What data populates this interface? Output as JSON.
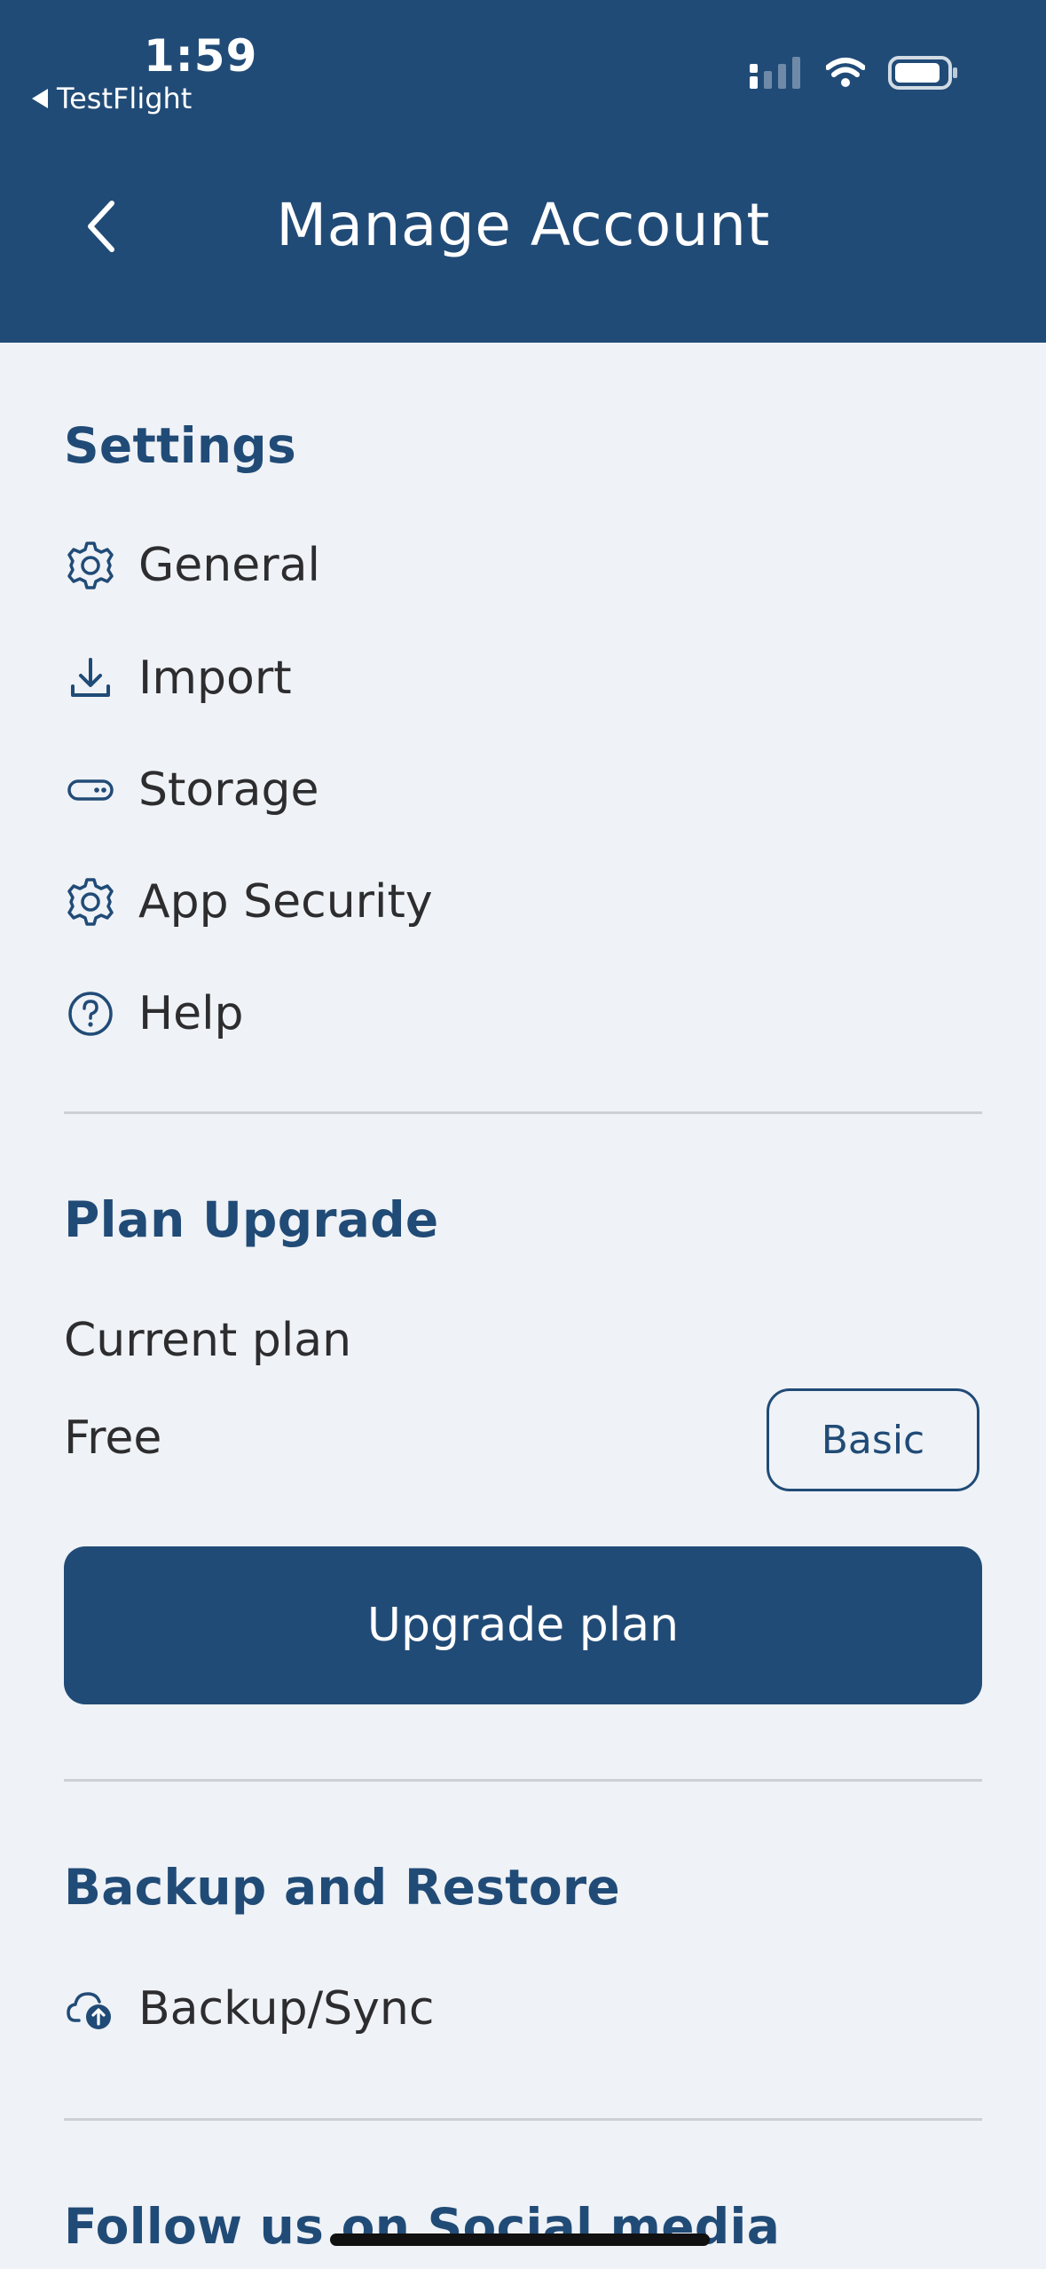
{
  "status_bar": {
    "time": "1:59",
    "back_app": "TestFlight"
  },
  "header": {
    "title": "Manage Account"
  },
  "settings": {
    "title": "Settings",
    "items": [
      {
        "label": "General",
        "icon": "gear-icon"
      },
      {
        "label": "Import",
        "icon": "download-icon"
      },
      {
        "label": "Storage",
        "icon": "storage-icon"
      },
      {
        "label": "App Security",
        "icon": "gear-icon"
      },
      {
        "label": "Help",
        "icon": "help-icon"
      }
    ]
  },
  "plan": {
    "title": "Plan Upgrade",
    "current_label": "Current plan",
    "current_value": "Free",
    "badge": "Basic",
    "upgrade_button": "Upgrade plan"
  },
  "backup": {
    "title": "Backup and Restore",
    "items": [
      {
        "label": "Backup/Sync",
        "icon": "cloud-upload-icon"
      }
    ]
  },
  "social": {
    "title": "Follow us on Social media"
  },
  "colors": {
    "primary": "#214b77",
    "background": "#eff2f6",
    "text": "#2d2d2f",
    "divider": "#cdd0d5"
  }
}
